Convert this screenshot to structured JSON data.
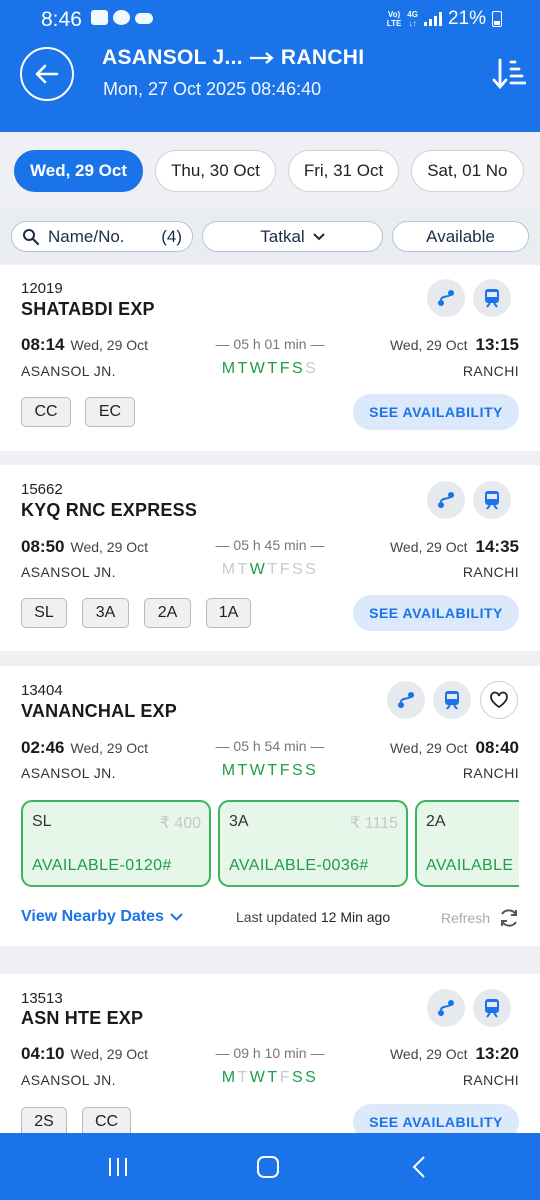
{
  "status": {
    "time": "8:46",
    "battery": "21%",
    "network": "Vo) LTE 4G"
  },
  "header": {
    "from": "ASANSOL J...",
    "to": "RANCHI",
    "datetime": "Mon, 27 Oct 2025 08:46:40"
  },
  "date_tabs": [
    "Wed, 29 Oct",
    "Thu, 30 Oct",
    "Fri, 31 Oct",
    "Sat, 01 No"
  ],
  "filters": {
    "name_label": "Name/No.",
    "name_count": "(4)",
    "quota": "Tatkal",
    "availability": "Available"
  },
  "trains": [
    {
      "number": "12019",
      "name": "SHATABDI EXP",
      "dep_time": "08:14",
      "dep_date": "Wed, 29 Oct",
      "arr_time": "13:15",
      "arr_date": "Wed, 29 Oct",
      "duration": "05 h 01 min",
      "from": "ASANSOL JN.",
      "to": "RANCHI",
      "classes": [
        "CC",
        "EC"
      ],
      "action": "SEE AVAILABILITY"
    },
    {
      "number": "15662",
      "name": "KYQ RNC EXPRESS",
      "dep_time": "08:50",
      "dep_date": "Wed, 29 Oct",
      "arr_time": "14:35",
      "arr_date": "Wed, 29 Oct",
      "duration": "05 h 45 min",
      "from": "ASANSOL JN.",
      "to": "RANCHI",
      "classes": [
        "SL",
        "3A",
        "2A",
        "1A"
      ],
      "action": "SEE AVAILABILITY"
    },
    {
      "number": "13404",
      "name": "VANANCHAL EXP",
      "dep_time": "02:46",
      "dep_date": "Wed, 29 Oct",
      "arr_time": "08:40",
      "arr_date": "Wed, 29 Oct",
      "duration": "05 h 54 min",
      "from": "ASANSOL JN.",
      "to": "RANCHI",
      "availability": [
        {
          "cls": "SL",
          "fare": "₹ 400",
          "status": "AVAILABLE-0120#"
        },
        {
          "cls": "3A",
          "fare": "₹ 1115",
          "status": "AVAILABLE-0036#"
        },
        {
          "cls": "2A",
          "fare": "",
          "status": "AVAILABLE"
        }
      ],
      "nearby": "View Nearby Dates",
      "updated_label": "Last updated",
      "updated_value": "12 Min ago",
      "refresh": "Refresh"
    },
    {
      "number": "13513",
      "name": "ASN HTE EXP",
      "dep_time": "04:10",
      "dep_date": "Wed, 29 Oct",
      "arr_time": "13:20",
      "arr_date": "Wed, 29 Oct",
      "duration": "09 h 10 min",
      "from": "ASANSOL JN.",
      "to": "RANCHI",
      "classes": [
        "2S",
        "CC"
      ],
      "action": "SEE AVAILABILITY"
    }
  ],
  "week_days": [
    "M",
    "T",
    "W",
    "T",
    "F",
    "S",
    "S"
  ],
  "run_days": [
    [
      true,
      true,
      true,
      true,
      true,
      true,
      false
    ],
    [
      false,
      false,
      true,
      false,
      false,
      false,
      false
    ],
    [
      true,
      true,
      true,
      true,
      true,
      true,
      true
    ],
    [
      true,
      false,
      true,
      true,
      false,
      true,
      true
    ]
  ],
  "colors": {
    "primary": "#1a73e8",
    "available": "#1e9e46",
    "chip_bg": "#dbe9fa"
  }
}
